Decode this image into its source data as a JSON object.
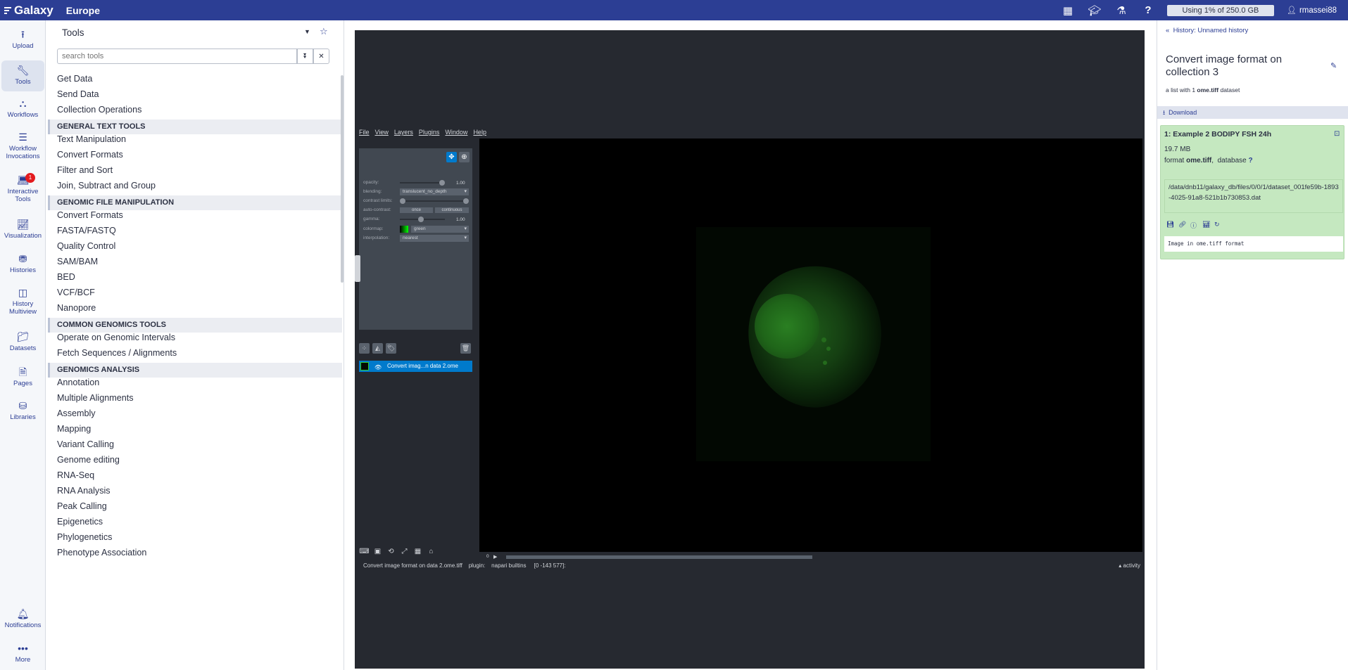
{
  "masthead": {
    "brand": "Galaxy",
    "subtitle": "Europe",
    "icons": [
      "apps-grid-icon",
      "graduation-cap-icon",
      "flask-icon",
      "help-icon"
    ],
    "quota": "Using 1% of 250.0 GB",
    "user": "rmassei88"
  },
  "activity": {
    "upload": "Upload",
    "tools": "Tools",
    "workflows": "Workflows",
    "invocations": "Workflow Invocations",
    "interactive": "Interactive Tools",
    "interactive_badge": "1",
    "visualization": "Visualization",
    "histories": "Histories",
    "multiview": "History Multiview",
    "datasets": "Datasets",
    "pages": "Pages",
    "libraries": "Libraries",
    "notifications": "Notifications",
    "more": "More"
  },
  "toolpanel": {
    "title": "Tools",
    "search_placeholder": "search tools",
    "items": [
      {
        "kind": "link",
        "label": "Get Data"
      },
      {
        "kind": "link",
        "label": "Send Data"
      },
      {
        "kind": "link",
        "label": "Collection Operations"
      },
      {
        "kind": "section",
        "label": "GENERAL TEXT TOOLS"
      },
      {
        "kind": "link",
        "label": "Text Manipulation"
      },
      {
        "kind": "link",
        "label": "Convert Formats"
      },
      {
        "kind": "link",
        "label": "Filter and Sort"
      },
      {
        "kind": "link",
        "label": "Join, Subtract and Group"
      },
      {
        "kind": "section",
        "label": "GENOMIC FILE MANIPULATION"
      },
      {
        "kind": "link",
        "label": "Convert Formats"
      },
      {
        "kind": "link",
        "label": "FASTA/FASTQ"
      },
      {
        "kind": "link",
        "label": "Quality Control"
      },
      {
        "kind": "link",
        "label": "SAM/BAM"
      },
      {
        "kind": "link",
        "label": "BED"
      },
      {
        "kind": "link",
        "label": "VCF/BCF"
      },
      {
        "kind": "link",
        "label": "Nanopore"
      },
      {
        "kind": "section",
        "label": "COMMON GENOMICS TOOLS"
      },
      {
        "kind": "link",
        "label": "Operate on Genomic Intervals"
      },
      {
        "kind": "link",
        "label": "Fetch Sequences / Alignments"
      },
      {
        "kind": "section",
        "label": "GENOMICS ANALYSIS"
      },
      {
        "kind": "link",
        "label": "Annotation"
      },
      {
        "kind": "link",
        "label": "Multiple Alignments"
      },
      {
        "kind": "link",
        "label": "Assembly"
      },
      {
        "kind": "link",
        "label": "Mapping"
      },
      {
        "kind": "link",
        "label": "Variant Calling"
      },
      {
        "kind": "link",
        "label": "Genome editing"
      },
      {
        "kind": "link",
        "label": "RNA-Seq"
      },
      {
        "kind": "link",
        "label": "RNA Analysis"
      },
      {
        "kind": "link",
        "label": "Peak Calling"
      },
      {
        "kind": "link",
        "label": "Epigenetics"
      },
      {
        "kind": "link",
        "label": "Phylogenetics"
      },
      {
        "kind": "link",
        "label": "Phenotype Association"
      }
    ]
  },
  "napari": {
    "menu": [
      "File",
      "View",
      "Layers",
      "Plugins",
      "Window",
      "Help"
    ],
    "controls": {
      "opacity_label": "opacity:",
      "opacity_value": "1.00",
      "blending_label": "blending:",
      "blending_value": "translucent_no_depth",
      "contrast_label": "contrast limits:",
      "auto_contrast_label": "auto-contrast:",
      "once_label": "once",
      "continuous_label": "continuous",
      "gamma_label": "gamma:",
      "gamma_value": "1.00",
      "colormap_label": "colormap:",
      "colormap_value": "green",
      "interpolation_label": "interpolation:",
      "interpolation_value": "nearest"
    },
    "layer_name": "Convert imag...n data 2.ome",
    "status": "Convert image format on data 2.ome.tiff    plugin:    napari builtins     [0 -143 577]:",
    "activity": "activity",
    "slider_start": "0",
    "slider_position_fraction": 0.47
  },
  "history": {
    "back_label": "History: Unnamed history",
    "title": "Convert image format on collection 3",
    "subtitle_prefix": "a list with 1 ",
    "subtitle_format": "ome.tiff",
    "subtitle_suffix": " dataset",
    "download_label": "Download",
    "item": {
      "title": "1: Example 2 BODIPY FSH 24h",
      "size": "19.7 MB",
      "format_prefix": "format ",
      "format_value": "ome.tiff",
      "database_label": ",  database ",
      "database_value": "?",
      "path": "/data/dnb11/galaxy_db/files/0/0/1/dataset_001fe59b-1893-4025-91a8-521b1b730853.dat",
      "peek": "Image in ome.tiff format"
    }
  },
  "colors": {
    "masthead": "#2c3e94",
    "dataset_ok": "#c5e8c0",
    "napari_bg": "#262930",
    "napari_selected": "#007acc"
  }
}
